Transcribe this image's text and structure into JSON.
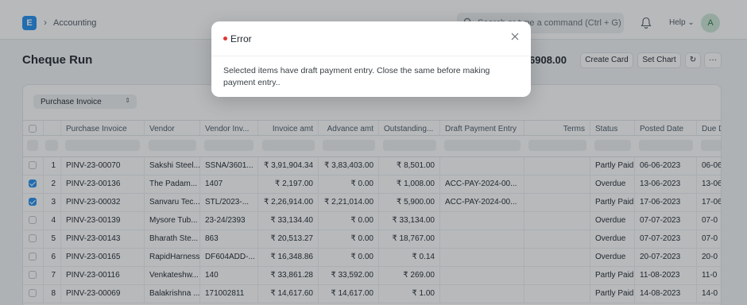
{
  "navbar": {
    "logo_letter": "E",
    "breadcrumb": "Accounting",
    "search_placeholder": "Search or type a command (Ctrl + G)",
    "help_label": "Help",
    "avatar_initial": "A"
  },
  "page": {
    "title": "Cheque Run",
    "total": "6908.00",
    "buttons": [
      "Create Card",
      "Set Chart"
    ]
  },
  "filter": {
    "doctype_select": "Purchase Invoice"
  },
  "table": {
    "columns": [
      "",
      "Purchase Invoice",
      "Vendor",
      "Vendor Inv...",
      "Invoice amt",
      "Advance amt",
      "Outstanding...",
      "Draft Payment Entry",
      "Terms",
      "Status",
      "Posted Date",
      "Due D"
    ],
    "rows": [
      {
        "checked": false,
        "idx": "1",
        "invoice": "PINV-23-00070",
        "vendor": "Sakshi Steel...",
        "vendor_inv": "SSNA/3601...",
        "invoice_amt": "₹ 3,91,904.34",
        "advance_amt": "₹ 3,83,403.00",
        "outstanding": "₹ 8,501.00",
        "draft": "",
        "terms": "",
        "status": "Partly Paid",
        "posted": "06-06-2023",
        "due": "06-06"
      },
      {
        "checked": true,
        "idx": "2",
        "invoice": "PINV-23-00136",
        "vendor": "The Padam...",
        "vendor_inv": "1407",
        "invoice_amt": "₹ 2,197.00",
        "advance_amt": "₹ 0.00",
        "outstanding": "₹ 1,008.00",
        "draft": "ACC-PAY-2024-00...",
        "terms": "",
        "status": "Overdue",
        "posted": "13-06-2023",
        "due": "13-06"
      },
      {
        "checked": true,
        "idx": "3",
        "invoice": "PINV-23-00032",
        "vendor": "Sanvaru Tec...",
        "vendor_inv": "STL/2023-...",
        "invoice_amt": "₹ 2,26,914.00",
        "advance_amt": "₹ 2,21,014.00",
        "outstanding": "₹ 5,900.00",
        "draft": "ACC-PAY-2024-00...",
        "terms": "",
        "status": "Partly Paid",
        "posted": "17-06-2023",
        "due": "17-06"
      },
      {
        "checked": false,
        "idx": "4",
        "invoice": "PINV-23-00139",
        "vendor": "Mysore Tub...",
        "vendor_inv": "23-24/2393",
        "invoice_amt": "₹ 33,134.40",
        "advance_amt": "₹ 0.00",
        "outstanding": "₹ 33,134.00",
        "draft": "",
        "terms": "",
        "status": "Overdue",
        "posted": "07-07-2023",
        "due": "07-0"
      },
      {
        "checked": false,
        "idx": "5",
        "invoice": "PINV-23-00143",
        "vendor": "Bharath Ste...",
        "vendor_inv": "863",
        "invoice_amt": "₹ 20,513.27",
        "advance_amt": "₹ 0.00",
        "outstanding": "₹ 18,767.00",
        "draft": "",
        "terms": "",
        "status": "Overdue",
        "posted": "07-07-2023",
        "due": "07-0"
      },
      {
        "checked": false,
        "idx": "6",
        "invoice": "PINV-23-00165",
        "vendor": "RapidHarness",
        "vendor_inv": "DF604ADD-...",
        "invoice_amt": "₹ 16,348.86",
        "advance_amt": "₹ 0.00",
        "outstanding": "₹ 0.14",
        "draft": "",
        "terms": "",
        "status": "Overdue",
        "posted": "20-07-2023",
        "due": "20-0"
      },
      {
        "checked": false,
        "idx": "7",
        "invoice": "PINV-23-00116",
        "vendor": "Venkateshw...",
        "vendor_inv": "140",
        "invoice_amt": "₹ 33,861.28",
        "advance_amt": "₹ 33,592.00",
        "outstanding": "₹ 269.00",
        "draft": "",
        "terms": "",
        "status": "Partly Paid",
        "posted": "11-08-2023",
        "due": "11-0"
      },
      {
        "checked": false,
        "idx": "8",
        "invoice": "PINV-23-00069",
        "vendor": "Balakrishna ...",
        "vendor_inv": "171002811",
        "invoice_amt": "₹ 14,617.60",
        "advance_amt": "₹ 14,617.00",
        "outstanding": "₹ 1.00",
        "draft": "",
        "terms": "",
        "status": "Partly Paid",
        "posted": "14-08-2023",
        "due": "14-0"
      }
    ]
  },
  "modal": {
    "title": "Error",
    "message": "Selected items have draft payment entry. Close the same before making payment entry..",
    "accent_color": "#e03636"
  }
}
